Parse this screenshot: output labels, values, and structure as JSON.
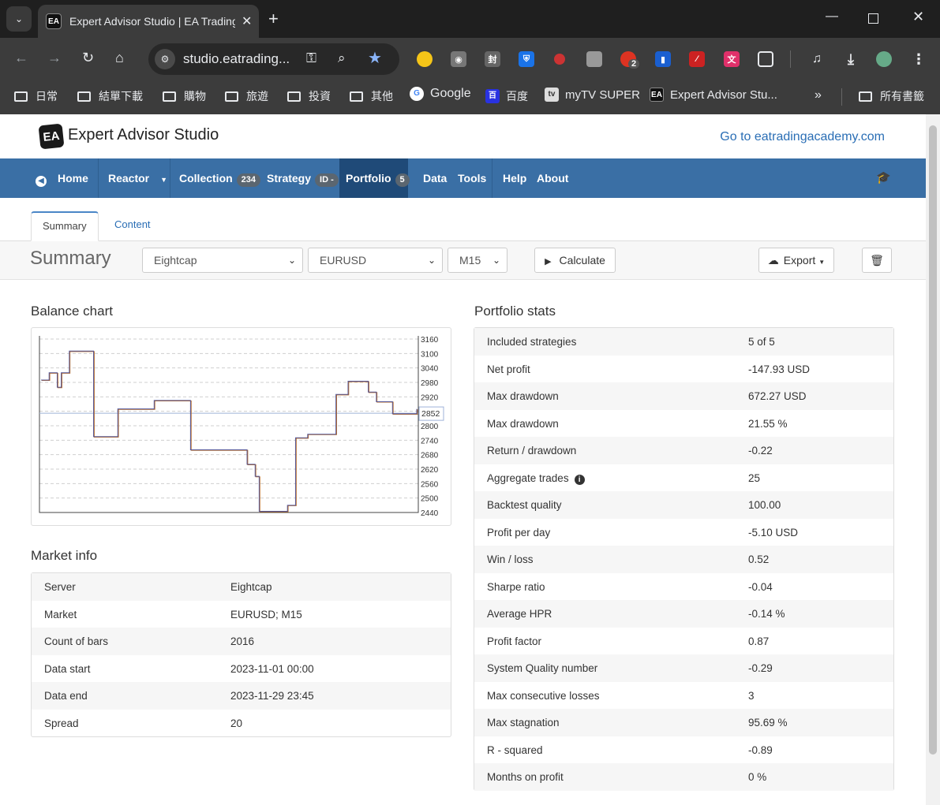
{
  "browser": {
    "tab_title": "Expert Advisor Studio | EA Trading Academy",
    "url": "studio.eatrading...",
    "new_tab": "+",
    "bookmarks": [
      "日常",
      "結單下載",
      "購物",
      "旅遊",
      "投資",
      "其他",
      "Google",
      "百度",
      "myTV SUPER",
      "Expert Advisor Stu...",
      "所有書籤"
    ],
    "extension_badges": {
      "adblock_count": "2"
    }
  },
  "header": {
    "logo_text": "EA",
    "brand": "Expert Advisor Studio",
    "academy_link": "Go to eatradingacademy.com"
  },
  "nav": {
    "home": "Home",
    "reactor": "Reactor",
    "collection": "Collection",
    "collection_count": "234",
    "strategy": "Strategy",
    "strategy_id": "ID -",
    "portfolio": "Portfolio",
    "portfolio_count": "5",
    "data": "Data",
    "tools": "Tools",
    "help": "Help",
    "about": "About"
  },
  "subtabs": {
    "summary": "Summary",
    "content": "Content"
  },
  "controls": {
    "title": "Summary",
    "server": "Eightcap",
    "symbol": "EURUSD",
    "period": "M15",
    "calculate": "Calculate",
    "export": "Export"
  },
  "balance_chart": {
    "title": "Balance chart"
  },
  "chart_data": {
    "type": "line",
    "title": "Balance chart",
    "xlabel": "",
    "ylabel": "",
    "ylim": [
      2440,
      3160
    ],
    "yticks": [
      3160,
      3100,
      3040,
      2980,
      2920,
      2860,
      2800,
      2740,
      2680,
      2620,
      2560,
      2500,
      2440
    ],
    "current_value": "2852",
    "baseline": 2852,
    "series": [
      {
        "values": [
          2990,
          2990,
          3020,
          3020,
          2960,
          3020,
          3020,
          3110,
          3110,
          3110,
          3110,
          3110,
          3110,
          2755,
          2755,
          2755,
          2755,
          2755,
          2755,
          2870,
          2870,
          2870,
          2870,
          2870,
          2870,
          2870,
          2870,
          2870,
          2905,
          2905,
          2905,
          2905,
          2905,
          2905,
          2905,
          2905,
          2905,
          2700,
          2700,
          2700,
          2700,
          2700,
          2700,
          2700,
          2700,
          2700,
          2700,
          2700,
          2700,
          2700,
          2700,
          2640,
          2640,
          2590,
          2445,
          2445,
          2445,
          2445,
          2445,
          2445,
          2445,
          2470,
          2470,
          2750,
          2750,
          2750,
          2765,
          2765,
          2765,
          2765,
          2765,
          2765,
          2765,
          2930,
          2930,
          2930,
          2985,
          2985,
          2985,
          2985,
          2985,
          2940,
          2940,
          2900,
          2900,
          2900,
          2900,
          2850,
          2850,
          2850,
          2850,
          2850,
          2850,
          2870
        ]
      }
    ]
  },
  "market_info": {
    "title": "Market info",
    "rows": [
      {
        "k": "Server",
        "v": "Eightcap"
      },
      {
        "k": "Market",
        "v": "EURUSD; M15"
      },
      {
        "k": "Count of bars",
        "v": "2016"
      },
      {
        "k": "Data start",
        "v": "2023-11-01 00:00"
      },
      {
        "k": "Data end",
        "v": "2023-11-29 23:45"
      },
      {
        "k": "Spread",
        "v": "20"
      }
    ]
  },
  "portfolio_stats": {
    "title": "Portfolio stats",
    "rows": [
      {
        "k": "Included strategies",
        "v": "5 of 5"
      },
      {
        "k": "Net profit",
        "v": "-147.93 USD"
      },
      {
        "k": "Max drawdown",
        "v": "672.27 USD"
      },
      {
        "k": "Max drawdown",
        "v": "21.55 %"
      },
      {
        "k": "Return / drawdown",
        "v": "-0.22"
      },
      {
        "k": "Aggregate trades",
        "v": "25"
      },
      {
        "k": "Backtest quality",
        "v": "100.00"
      },
      {
        "k": "Profit per day",
        "v": "-5.10 USD"
      },
      {
        "k": "Win / loss",
        "v": "0.52"
      },
      {
        "k": "Sharpe ratio",
        "v": "-0.04"
      },
      {
        "k": "Average HPR",
        "v": "-0.14 %"
      },
      {
        "k": "Profit factor",
        "v": "0.87"
      },
      {
        "k": "System Quality number",
        "v": "-0.29"
      },
      {
        "k": "Max consecutive losses",
        "v": "3"
      },
      {
        "k": "Max stagnation",
        "v": "95.69 %"
      },
      {
        "k": "R - squared",
        "v": "-0.89"
      },
      {
        "k": "Months on profit",
        "v": "0 %"
      }
    ]
  }
}
